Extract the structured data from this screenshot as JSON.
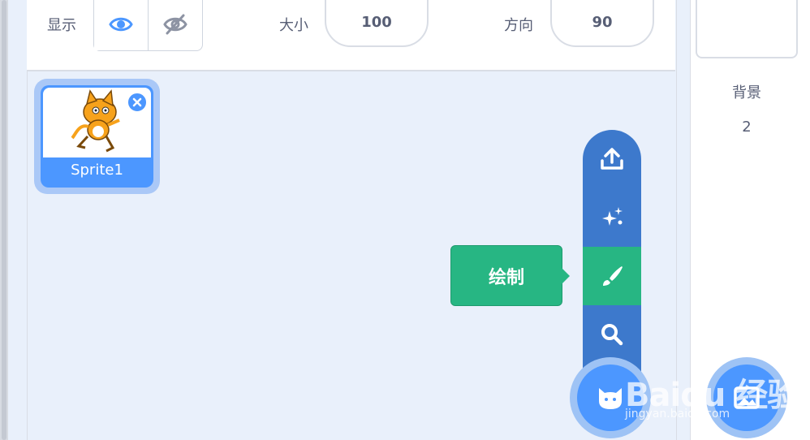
{
  "sprite_info": {
    "show_label": "显示",
    "size_label": "大小",
    "size_value": "100",
    "direction_label": "方向",
    "direction_value": "90"
  },
  "sprite_list": [
    {
      "name": "Sprite1",
      "selected": true
    }
  ],
  "stage": {
    "backdrop_label": "背景",
    "backdrop_count": "2"
  },
  "sprite_menu": {
    "items": [
      "upload-icon",
      "surprise-icon",
      "paint-icon",
      "search-icon"
    ],
    "active_tooltip": "绘制"
  },
  "watermark": {
    "logo": "Baidu 经验",
    "url": "jingyan.baidu.com"
  },
  "colors": {
    "accent_blue": "#4c97ff",
    "menu_blue": "#3d79cc",
    "paint_green": "#27b683",
    "text_gray": "#575e75"
  }
}
